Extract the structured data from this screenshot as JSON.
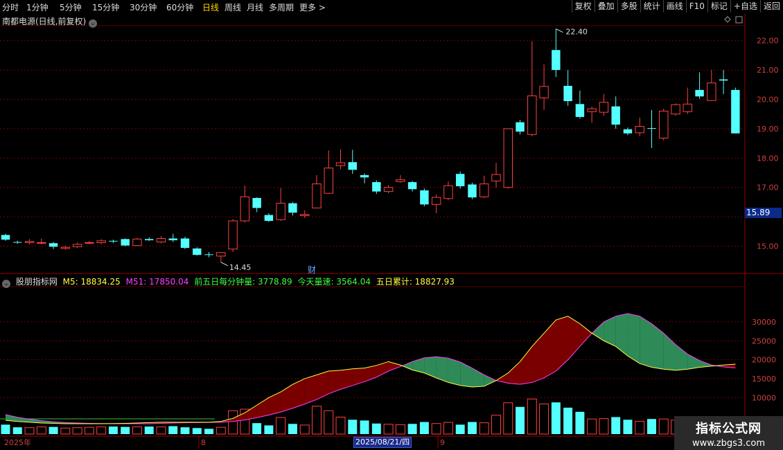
{
  "toolbar": {
    "periods": [
      "分时",
      "1分钟",
      "5分钟",
      "15分钟",
      "30分钟",
      "60分钟",
      "日线",
      "周线",
      "月线",
      "多周期",
      "更多 >"
    ],
    "active_period": "日线",
    "right_buttons": [
      "复权",
      "叠加",
      "多股",
      "统计",
      "画线",
      "F10",
      "标记",
      "+自选",
      "返回"
    ]
  },
  "chart_title": "南都电源(日线,前复权)",
  "dropdown_glyph": "⌄",
  "indicator": {
    "name": "股朋指标网",
    "m5": "M5: 18834.25",
    "m51": "M51: 17850.04",
    "five_day_per_min": "前五日每分钟量: 3778.89",
    "today_speed": "今天量速: 3564.04",
    "five_day_total": "五日累计: 18827.93"
  },
  "colors": {
    "up": "#ff4040",
    "down": "#54ffff",
    "m5": "#ffff40",
    "m51": "#ff40ff",
    "bear_fill": "#7a0000",
    "bull_fill": "#2e8b57",
    "grid": "#7a0000"
  },
  "price_axis": {
    "ticks": [
      "22.00",
      "21.00",
      "20.00",
      "19.00",
      "18.00",
      "17.00",
      "15.00"
    ],
    "current": "15.89"
  },
  "volume_axis": {
    "ticks": [
      "30000",
      "25000",
      "20000",
      "15000",
      "10000"
    ]
  },
  "annotations": {
    "high": "22.40",
    "low": "14.45",
    "cai": "财"
  },
  "x_axis": {
    "labels": [
      "2025年",
      "8",
      "9"
    ],
    "cursor_date": "2025/08/21/四"
  },
  "watermark": {
    "line1": "指标公式网",
    "line2": "www.zbgs3.com"
  },
  "chart_data": {
    "type": "candlestick",
    "candles": [
      [
        15.38,
        15.22,
        15.42,
        15.18
      ],
      [
        15.14,
        15.12,
        15.18,
        15.08
      ],
      [
        15.12,
        15.16,
        15.24,
        15.06
      ],
      [
        15.1,
        15.12,
        15.26,
        15.06
      ],
      [
        15.1,
        14.98,
        15.14,
        14.9
      ],
      [
        14.92,
        14.96,
        15.02,
        14.88
      ],
      [
        14.98,
        15.06,
        15.12,
        14.94
      ],
      [
        15.1,
        15.12,
        15.18,
        15.06
      ],
      [
        15.12,
        15.18,
        15.24,
        15.06
      ],
      [
        15.18,
        15.16,
        15.22,
        15.1
      ],
      [
        15.24,
        15.02,
        15.26,
        15.0
      ],
      [
        15.02,
        15.24,
        15.28,
        15.0
      ],
      [
        15.24,
        15.2,
        15.3,
        15.18
      ],
      [
        15.14,
        15.26,
        15.34,
        15.1
      ],
      [
        15.26,
        15.2,
        15.42,
        15.14
      ],
      [
        15.26,
        14.94,
        15.32,
        14.9
      ],
      [
        14.92,
        14.7,
        14.96,
        14.68
      ],
      [
        14.72,
        14.7,
        14.8,
        14.62
      ],
      [
        14.66,
        14.78,
        14.8,
        14.45
      ],
      [
        14.9,
        15.86,
        15.92,
        14.8
      ],
      [
        15.86,
        16.68,
        17.06,
        15.8
      ],
      [
        16.64,
        16.3,
        16.66,
        16.16
      ],
      [
        16.06,
        15.86,
        16.12,
        15.82
      ],
      [
        15.9,
        16.46,
        16.98,
        15.86
      ],
      [
        16.46,
        16.14,
        16.5,
        16.04
      ],
      [
        16.04,
        16.08,
        16.22,
        15.96
      ],
      [
        16.3,
        17.12,
        17.42,
        16.3
      ],
      [
        16.8,
        17.66,
        18.26,
        16.78
      ],
      [
        17.74,
        17.84,
        18.3,
        17.62
      ],
      [
        17.86,
        17.6,
        18.28,
        17.46
      ],
      [
        17.42,
        17.34,
        17.48,
        17.14
      ],
      [
        17.18,
        16.86,
        17.24,
        16.78
      ],
      [
        16.86,
        17.0,
        17.08,
        16.8
      ],
      [
        17.2,
        17.26,
        17.42,
        17.16
      ],
      [
        17.18,
        16.94,
        17.22,
        16.86
      ],
      [
        16.9,
        16.42,
        16.96,
        16.36
      ],
      [
        16.42,
        16.66,
        16.76,
        16.12
      ],
      [
        16.62,
        17.06,
        17.2,
        16.56
      ],
      [
        17.46,
        17.04,
        17.54,
        16.96
      ],
      [
        17.1,
        16.66,
        17.16,
        16.6
      ],
      [
        16.68,
        17.12,
        17.4,
        16.64
      ],
      [
        17.22,
        17.44,
        17.84,
        17.0
      ],
      [
        17.0,
        19.0,
        19.0,
        16.96
      ],
      [
        19.22,
        18.9,
        19.3,
        18.8
      ],
      [
        18.8,
        20.12,
        21.98,
        18.74
      ],
      [
        20.05,
        20.44,
        21.2,
        19.64
      ],
      [
        21.68,
        21.0,
        22.4,
        20.76
      ],
      [
        20.46,
        19.94,
        21.0,
        19.78
      ],
      [
        19.84,
        19.4,
        20.3,
        19.34
      ],
      [
        19.58,
        19.68,
        19.76,
        19.2
      ],
      [
        19.56,
        19.9,
        20.18,
        19.44
      ],
      [
        19.76,
        19.14,
        20.1,
        19.0
      ],
      [
        18.98,
        18.84,
        19.04,
        18.78
      ],
      [
        18.86,
        19.08,
        19.38,
        18.74
      ],
      [
        19.02,
        19.0,
        19.64,
        18.34
      ],
      [
        18.68,
        19.6,
        19.68,
        18.6
      ],
      [
        19.5,
        19.82,
        19.86,
        19.44
      ],
      [
        19.58,
        19.84,
        20.4,
        19.5
      ],
      [
        20.32,
        20.1,
        20.92,
        20.02
      ],
      [
        19.96,
        20.56,
        21.0,
        19.94
      ],
      [
        20.68,
        20.64,
        21.0,
        20.18
      ],
      [
        20.32,
        18.84,
        20.4,
        18.84
      ]
    ],
    "m5": [
      4000,
      3700,
      3500,
      3300,
      3200,
      3100,
      3100,
      3100,
      3100,
      3150,
      3200,
      3300,
      3400,
      3500,
      3500,
      3500,
      3500,
      3500,
      3700,
      4500,
      6000,
      8000,
      10000,
      11500,
      13500,
      15000,
      16000,
      17000,
      17200,
      17600,
      17800,
      18500,
      19500,
      18600,
      17300,
      16500,
      15200,
      14000,
      13200,
      12800,
      13000,
      14500,
      16500,
      19500,
      23500,
      27000,
      30500,
      31500,
      29500,
      27000,
      25000,
      23500,
      21000,
      19000,
      18000,
      17500,
      17200,
      17500,
      18000,
      18300,
      18600,
      18834
    ],
    "m51": [
      5500,
      4800,
      4300,
      3900,
      3600,
      3400,
      3300,
      3200,
      3150,
      3100,
      3100,
      3100,
      3100,
      3200,
      3300,
      3350,
      3400,
      3450,
      3500,
      3700,
      4100,
      4700,
      5400,
      6200,
      7200,
      8300,
      9500,
      11000,
      12200,
      13200,
      14200,
      15400,
      17000,
      18200,
      19500,
      20500,
      20800,
      20400,
      19400,
      17800,
      16000,
      14500,
      13800,
      13500,
      14000,
      15200,
      17000,
      20000,
      23500,
      27000,
      30000,
      31500,
      32200,
      31500,
      29500,
      27000,
      24000,
      21500,
      19800,
      18600,
      18100,
      17850
    ],
    "volume": [
      2500,
      1800,
      1700,
      1900,
      1900,
      1600,
      1700,
      1800,
      1900,
      2000,
      1900,
      1900,
      2000,
      1900,
      2100,
      1800,
      1600,
      1400,
      1800,
      6200,
      6600,
      2900,
      2300,
      4400,
      2700,
      2400,
      7400,
      6200,
      4500,
      3800,
      3600,
      2800,
      2600,
      2500,
      2700,
      3200,
      2800,
      3100,
      2500,
      3200,
      3000,
      5000,
      8300,
      7200,
      9300,
      8000,
      8400,
      7000,
      5900,
      4000,
      4100,
      4500,
      3800,
      3400,
      4000,
      4000,
      3700,
      4100,
      3900,
      4300,
      4200,
      4400
    ]
  }
}
